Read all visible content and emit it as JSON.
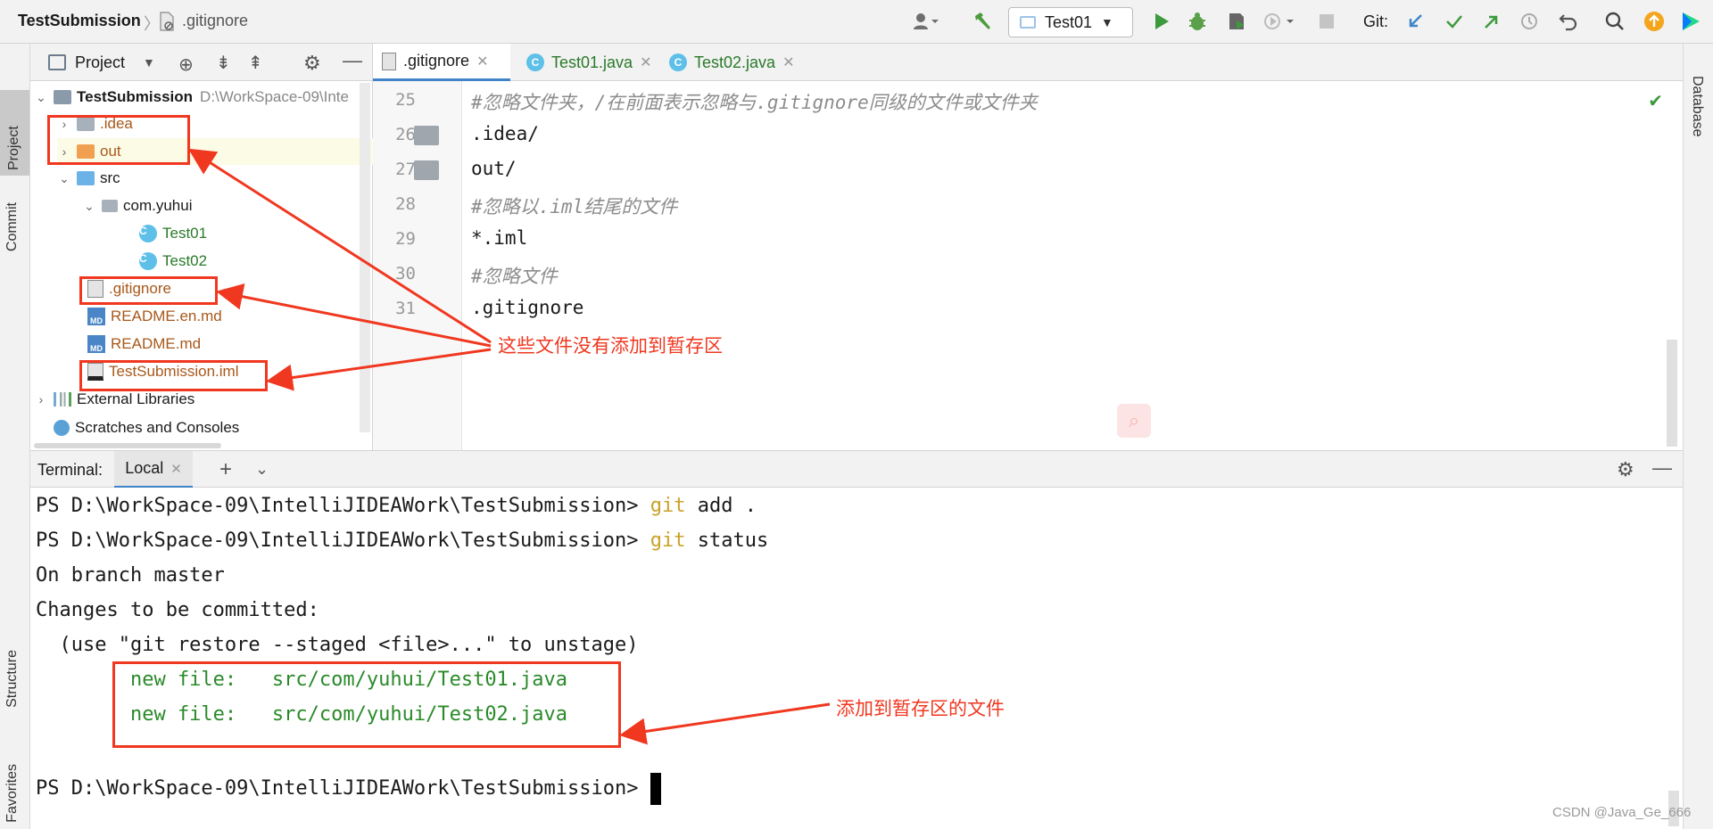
{
  "topbar": {
    "project": "TestSubmission",
    "separator": "〉",
    "file": ".gitignore",
    "run_config": "Test01",
    "git_label": "Git:"
  },
  "left_strip": {
    "project": "Project",
    "commit": "Commit",
    "structure": "Structure",
    "favorites": "Favorites"
  },
  "right_strip": {
    "database": "Database"
  },
  "project_panel": {
    "title": "Project",
    "tree": [
      {
        "label": "TestSubmission",
        "path": "D:\\WorkSpace-09\\Inte"
      },
      {
        "label": ".idea"
      },
      {
        "label": "out"
      },
      {
        "label": "src"
      },
      {
        "label": "com.yuhui"
      },
      {
        "label": "Test01"
      },
      {
        "label": "Test02"
      },
      {
        "label": ".gitignore"
      },
      {
        "label": "README.en.md"
      },
      {
        "label": "README.md"
      },
      {
        "label": "TestSubmission.iml"
      },
      {
        "label": "External Libraries"
      },
      {
        "label": "Scratches and Consoles"
      }
    ]
  },
  "editor": {
    "tabs": [
      ".gitignore",
      "Test01.java",
      "Test02.java"
    ],
    "line_numbers": [
      "25",
      "26",
      "27",
      "28",
      "29",
      "30",
      "31"
    ],
    "lines": [
      "#忽略文件夹，/在前面表示忽略与.gitignore同级的文件或文件夹",
      ".idea/",
      "out/",
      "#忽略以.iml结尾的文件",
      "*.iml",
      "#忽略文件",
      ".gitignore"
    ]
  },
  "terminal": {
    "title": "Terminal:",
    "tab": "Local",
    "prompt": "PS D:\\WorkSpace-09\\IntelliJIDEAWork\\TestSubmission> ",
    "cmd1_git": "git",
    "cmd1_rest": " add .",
    "cmd2_git": "git",
    "cmd2_rest": " status",
    "line3": "On branch master",
    "line4": "Changes to be committed:",
    "line5": "  (use \"git restore --staged <file>...\" to unstage)",
    "new1": "        new file:   src/com/yuhui/Test01.java",
    "new2": "        new file:   src/com/yuhui/Test02.java"
  },
  "annotations": {
    "not_staged": "这些文件没有添加到暂存区",
    "staged": "添加到暂存区的文件"
  },
  "watermark": "CSDN @Java_Ge_666",
  "colors": {
    "accent": "#4083c9",
    "annotation_red": "#f0371f",
    "untracked_file": "#a8581a",
    "added_file": "#2a7a2a"
  }
}
